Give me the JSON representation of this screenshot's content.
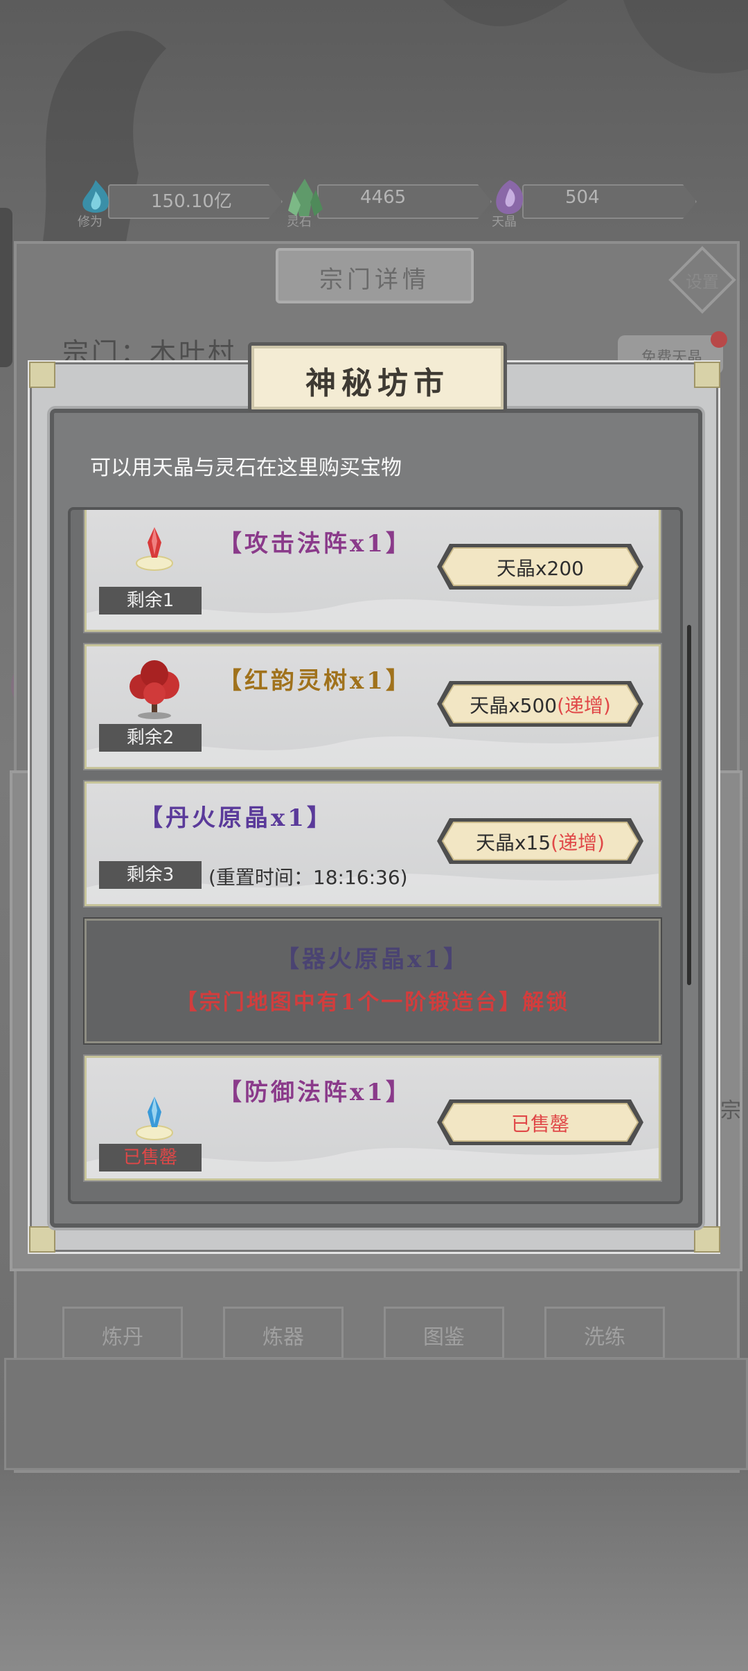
{
  "resources": [
    {
      "name": "修为",
      "value": "150.10亿",
      "icon": "cultivation-flame-icon",
      "color": "#3fa9c8"
    },
    {
      "name": "灵石",
      "value": "4465",
      "icon": "spirit-stone-crystal-icon",
      "color": "#6fb07a"
    },
    {
      "name": "天晶",
      "value": "504",
      "icon": "heaven-crystal-icon",
      "color": "#9a73b7"
    }
  ],
  "background": {
    "sect_title": "宗门详情",
    "settings": "设置",
    "sect_name": "宗门：木叶村",
    "free_tag": "免费天晶",
    "right_fragment": "宗",
    "bottom_buttons": [
      "炼丹",
      "炼器",
      "图鉴",
      "洗练"
    ]
  },
  "modal": {
    "title": "神秘坊市",
    "description": "可以用天晶与灵石在这里购买宝物",
    "items": [
      {
        "name": "【攻击法阵x1】",
        "stock": "剩余1",
        "price": "天晶x200",
        "price_suffix": "",
        "icon": "attack-array-crystal-icon",
        "name_color": "#8a3a8a"
      },
      {
        "name": "【红韵灵树x1】",
        "stock": "剩余2",
        "price": "天晶x500",
        "price_suffix": "(递增)",
        "icon": "red-spirit-tree-icon",
        "name_color": "#a0721c"
      },
      {
        "name": "【丹火原晶x1】",
        "stock": "剩余3",
        "reset": "(重置时间：18:16:36)",
        "price": "天晶x15",
        "price_suffix": "(递增)",
        "name_color": "#5a3a9a"
      },
      {
        "name": "【器火原晶x1】",
        "locked": true,
        "condition": "【宗门地图中有1个一阶锻造台】解锁"
      },
      {
        "name": "【防御法阵x1】",
        "stock": "已售罄",
        "price": "已售罄",
        "sold_out": true,
        "icon": "defense-array-crystal-icon",
        "name_color": "#8a3a8a"
      }
    ]
  }
}
